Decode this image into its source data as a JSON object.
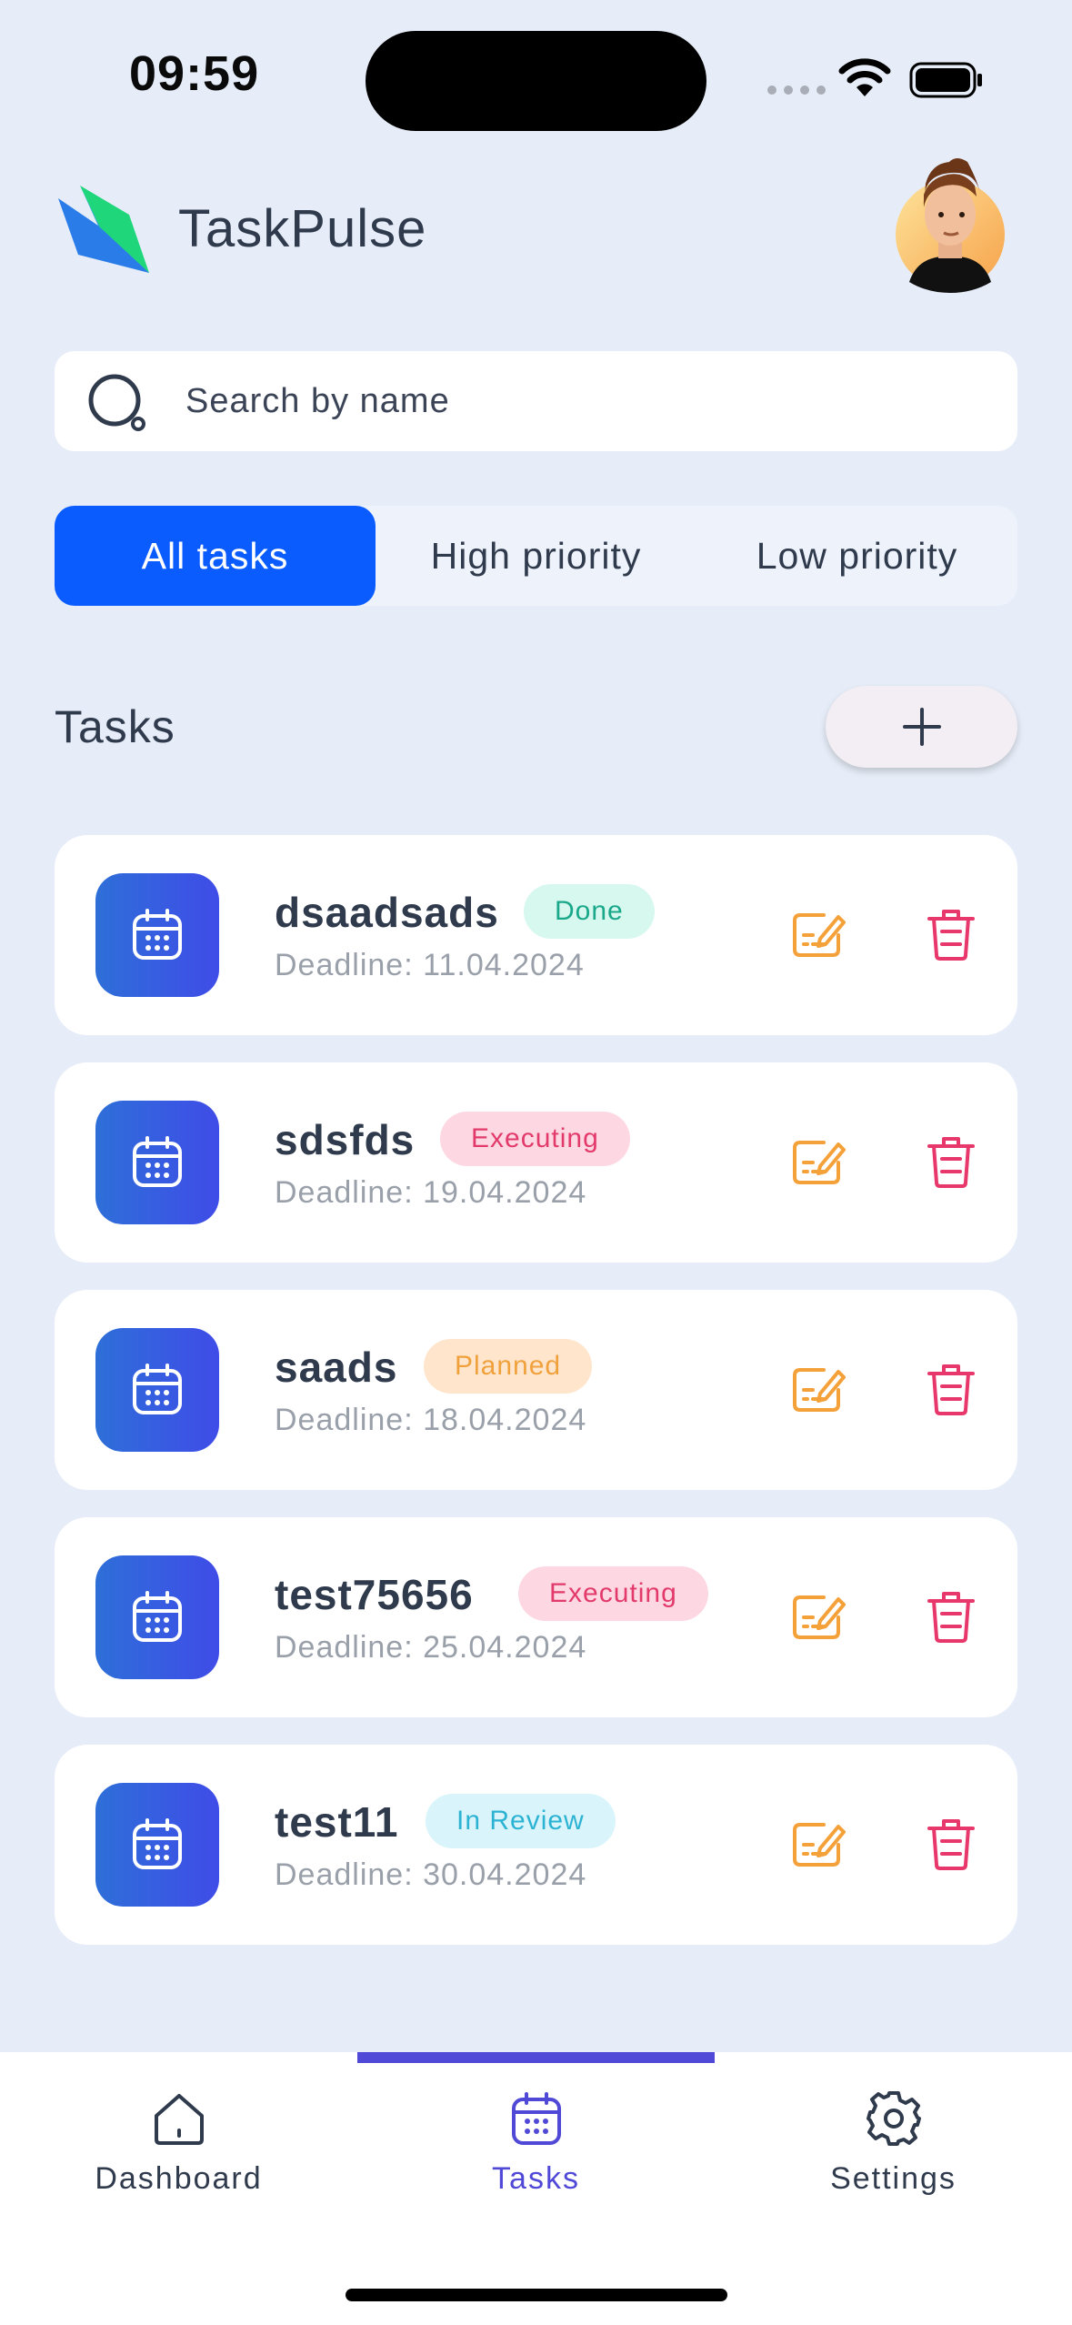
{
  "status_bar": {
    "time": "09:59"
  },
  "header": {
    "app_title": "TaskPulse",
    "logo_icon": "taskpulse-logo",
    "avatar_icon": "user-avatar"
  },
  "search": {
    "placeholder": "Search by name",
    "value": ""
  },
  "filters": {
    "tabs": [
      {
        "label": "All tasks",
        "active": true
      },
      {
        "label": "High priority",
        "active": false
      },
      {
        "label": "Low priority",
        "active": false
      }
    ]
  },
  "tasks_section": {
    "heading": "Tasks",
    "add_icon": "plus-icon"
  },
  "tasks": [
    {
      "name": "dsaadsads",
      "status": "Done",
      "deadline": "Deadline: 11.04.2024"
    },
    {
      "name": "sdsfds",
      "status": "Executing",
      "deadline": "Deadline: 19.04.2024"
    },
    {
      "name": "saads",
      "status": "Planned",
      "deadline": "Deadline: 18.04.2024"
    },
    {
      "name": "test75656",
      "status": "Executing",
      "deadline": "Deadline: 25.04.2024"
    },
    {
      "name": "test11",
      "status": "In Review",
      "deadline": "Deadline: 30.04.2024"
    }
  ],
  "status_colors": {
    "Done": {
      "bg": "#d6f8ef",
      "fg": "#1aa88b"
    },
    "Executing": {
      "bg": "#fdd8e2",
      "fg": "#e23a6b"
    },
    "Planned": {
      "bg": "#ffe5cc",
      "fg": "#f0a13c"
    },
    "In Review": {
      "bg": "#d9f5fb",
      "fg": "#2cb3d3"
    }
  },
  "colors": {
    "accent": "#0a5cff",
    "nav_active": "#5048d6",
    "edit": "#f5a13a",
    "delete": "#e8376a"
  },
  "bottom_nav": {
    "items": [
      {
        "label": "Dashboard",
        "icon": "home-icon",
        "active": false
      },
      {
        "label": "Tasks",
        "icon": "calendar-icon",
        "active": true
      },
      {
        "label": "Settings",
        "icon": "gear-icon",
        "active": false
      }
    ]
  }
}
